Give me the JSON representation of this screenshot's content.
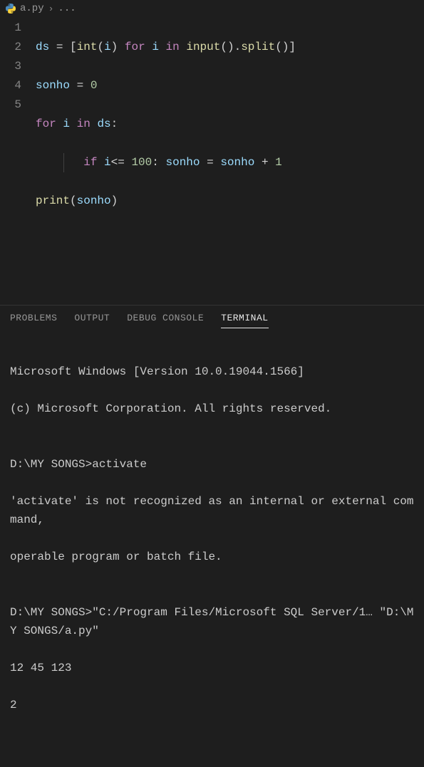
{
  "breadcrumb": {
    "file": "a.py",
    "separator": "...",
    "icon": "python-icon"
  },
  "editor": {
    "lineNumbers": [
      "1",
      "2",
      "3",
      "4",
      "5"
    ],
    "code": {
      "l1": {
        "ds": "ds",
        "eq": "=",
        "lb": "[",
        "int": "int",
        "lp": "(",
        "i1": "i",
        "rp": ")",
        "for": "for",
        "i2": "i",
        "in": "in",
        "input": "input",
        "lp2": "(",
        "rp2": ")",
        "dot": ".",
        "split": "split",
        "lp3": "(",
        "rp3": ")",
        "rb": "]"
      },
      "l2": {
        "sonho": "sonho",
        "eq": "=",
        "zero": "0"
      },
      "l3": {
        "for": "for",
        "i": "i",
        "in": "in",
        "ds": "ds",
        "colon": ":"
      },
      "l4": {
        "if": "if",
        "i": "i",
        "le": "<=",
        "hundred": "100",
        "colon": ":",
        "sonho1": "sonho",
        "eq": "=",
        "sonho2": "sonho",
        "plus": "+",
        "one": "1"
      },
      "l5": {
        "print": "print",
        "lp": "(",
        "sonho": "sonho",
        "rp": ")"
      }
    }
  },
  "panel": {
    "tabs": {
      "problems": "PROBLEMS",
      "output": "OUTPUT",
      "debug": "DEBUG CONSOLE",
      "terminal": "TERMINAL"
    },
    "activeTab": "terminal",
    "terminal": {
      "line1": "Microsoft Windows [Version 10.0.19044.1566]",
      "line2": "(c) Microsoft Corporation. All rights reserved.",
      "line3": "",
      "line4": "D:\\MY SONGS>activate",
      "line5": "'activate' is not recognized as an internal or external command,",
      "line6": "operable program or batch file.",
      "line7": "",
      "line8": "D:\\MY SONGS>\"C:/Program Files/Microsoft SQL Server/1… \"D:\\MY SONGS/a.py\"",
      "line9": "12 45 123",
      "line10": "2"
    }
  }
}
